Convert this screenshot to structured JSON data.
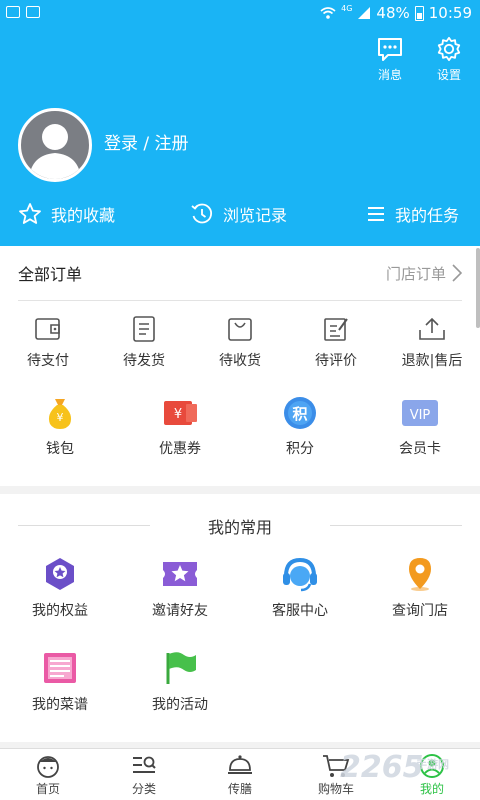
{
  "status_bar": {
    "network": "4G",
    "battery": "48%",
    "time": "10:59"
  },
  "header": {
    "messages_label": "消息",
    "settings_label": "设置",
    "login_text": "登录 / 注册",
    "quick_links": [
      {
        "label": "我的收藏",
        "icon": "star-icon"
      },
      {
        "label": "浏览记录",
        "icon": "history-icon"
      },
      {
        "label": "我的任务",
        "icon": "list-icon"
      }
    ]
  },
  "orders": {
    "title": "全部订单",
    "store_link": "门店订单",
    "status_items": [
      {
        "label": "待支付",
        "icon": "wallet-icon"
      },
      {
        "label": "待发货",
        "icon": "document-icon"
      },
      {
        "label": "待收货",
        "icon": "shopping-bag-icon"
      },
      {
        "label": "待评价",
        "icon": "edit-icon"
      },
      {
        "label": "退款|售后",
        "icon": "upload-tray-icon"
      }
    ],
    "assets": [
      {
        "label": "钱包",
        "icon": "money-bag-icon"
      },
      {
        "label": "优惠券",
        "icon": "coupon-icon"
      },
      {
        "label": "积分",
        "icon": "points-icon",
        "glyph": "积"
      },
      {
        "label": "会员卡",
        "icon": "vip-card-icon",
        "glyph": "VIP"
      }
    ]
  },
  "common": {
    "title": "我的常用",
    "items": [
      {
        "label": "我的权益",
        "icon": "badge-icon"
      },
      {
        "label": "邀请好友",
        "icon": "ticket-star-icon"
      },
      {
        "label": "客服中心",
        "icon": "headset-icon"
      },
      {
        "label": "查询门店",
        "icon": "location-pin-icon"
      },
      {
        "label": "我的菜谱",
        "icon": "newspaper-icon"
      },
      {
        "label": "我的活动",
        "icon": "flag-icon"
      }
    ]
  },
  "tabbar": {
    "tabs": [
      {
        "label": "首页",
        "icon": "home-face-icon"
      },
      {
        "label": "分类",
        "icon": "category-search-icon"
      },
      {
        "label": "传膳",
        "icon": "dish-cover-icon"
      },
      {
        "label": "购物车",
        "icon": "cart-icon"
      },
      {
        "label": "我的",
        "icon": "profile-icon",
        "active": true
      }
    ]
  },
  "watermark": {
    "text": "2265",
    "sub": "手游网"
  },
  "colors": {
    "brand_blue": "#1ab4f5",
    "active_green": "#2dc246"
  }
}
